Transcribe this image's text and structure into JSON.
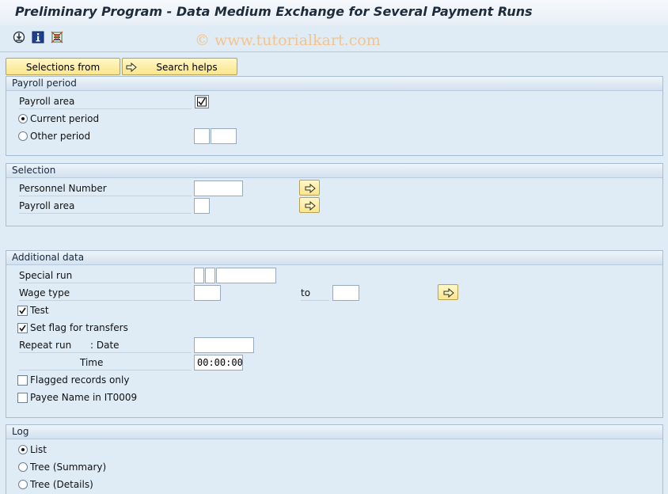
{
  "window": {
    "title": "Preliminary Program - Data Medium Exchange for Several Payment Runs"
  },
  "toolbar": {
    "icons": [
      "execute-icon",
      "info-icon",
      "selection-options-icon"
    ]
  },
  "watermark": "© www.tutorialkart.com",
  "buttons": {
    "selections_from": "Selections from",
    "search_helps": "Search helps"
  },
  "payroll_period": {
    "heading": "Payroll period",
    "payroll_area_label": "Payroll area",
    "current_period_label": "Current period",
    "other_period_label": "Other period",
    "current_period_selected": true
  },
  "selection": {
    "heading": "Selection",
    "personnel_number_label": "Personnel Number",
    "payroll_area_label": "Payroll area"
  },
  "additional_data": {
    "heading": "Additional data",
    "special_run_label": "Special run",
    "wage_type_label": "Wage type",
    "to_label": "to",
    "test_label": "Test",
    "test_checked": true,
    "set_flag_label": "Set flag for transfers",
    "set_flag_checked": true,
    "repeat_run_label": "Repeat run",
    "date_label": ": Date",
    "time_label": "Time",
    "time_value": "00:00:00",
    "flagged_only_label": "Flagged records only",
    "flagged_only_checked": false,
    "payee_name_label": "Payee Name in IT0009",
    "payee_name_checked": false
  },
  "log": {
    "heading": "Log",
    "list_label": "List",
    "tree_summary_label": "Tree (Summary)",
    "tree_details_label": "Tree (Details)",
    "selected": "List"
  }
}
